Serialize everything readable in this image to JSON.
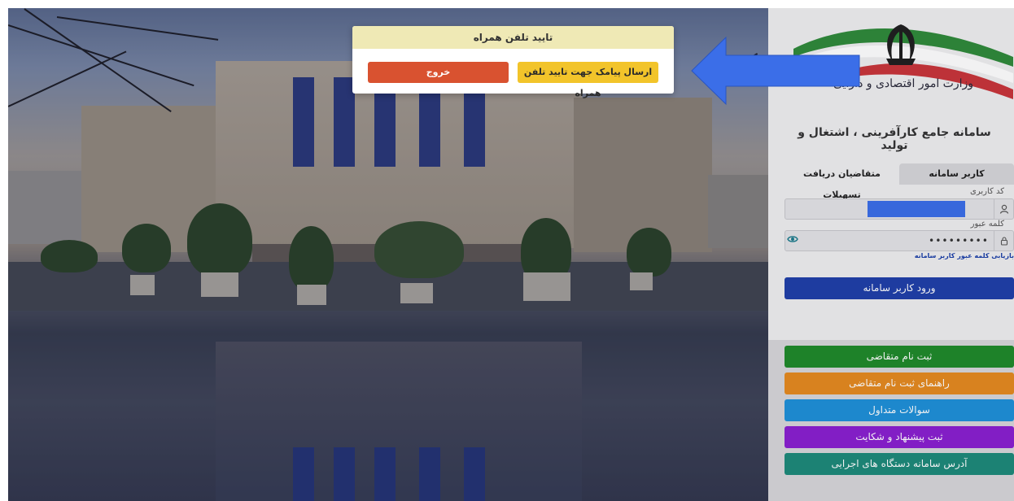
{
  "modal": {
    "title": "تایید تلفن همراه",
    "send_sms_label": "ارسال پیامک جهت تایید تلفن همراه",
    "exit_label": "خروج"
  },
  "sidebar": {
    "ministry_name": "وزارت امور اقتصادی و دارایی",
    "system_title": "سامانه جامع کارآفرینی ، اشتغال و تولید",
    "tabs": [
      {
        "label": "کاربر سامانه",
        "active": true
      },
      {
        "label": "متقاضیان دریافت تسهیلات",
        "active": false
      }
    ],
    "username_label": "کد کاربری",
    "password_label": "کلمه عبور",
    "password_value": "•••••••••",
    "forgot_password": "بازیابی کلمه عبور کاربر سامانه",
    "login_button": "ورود کاربر سامانه",
    "links": [
      {
        "label": "ثبت نام متقاضی",
        "color": "#1f8a2a"
      },
      {
        "label": "راهنمای ثبت نام متقاضی",
        "color": "#e58a1f"
      },
      {
        "label": "سوالات متداول",
        "color": "#1e90d8"
      },
      {
        "label": "ثبت پیشنهاد و شکایت",
        "color": "#8a1fd0"
      },
      {
        "label": "آدرس سامانه دستگاه های اجرایی",
        "color": "#1d8a7a"
      }
    ]
  },
  "colors": {
    "login_button": "#1f3fa8",
    "send_sms_button": "#f2c42a",
    "exit_button": "#d95230",
    "arrow": "#3b6ee8"
  },
  "icons": {
    "user": "user-icon",
    "lock": "lock-icon",
    "eye": "eye-icon"
  }
}
